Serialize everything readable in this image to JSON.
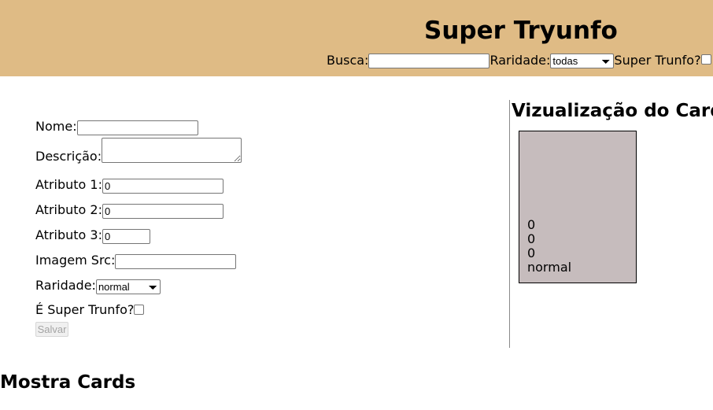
{
  "header": {
    "title": "Super Tryunfo",
    "filters": {
      "search_label": "Busca:",
      "search_value": "",
      "rarity_label": "Raridade:",
      "rarity_selected": "todas",
      "trunfo_label": "Super Trunfo?"
    }
  },
  "form": {
    "name_label": "Nome:",
    "name_value": "",
    "description_label": "Descrição:",
    "description_value": "",
    "attr1_label": "Atributo 1:",
    "attr1_value": "0",
    "attr2_label": "Atributo 2:",
    "attr2_value": "0",
    "attr3_label": "Atributo 3:",
    "attr3_value": "0",
    "image_label": "Imagem Src:",
    "image_value": "",
    "rarity_label": "Raridade:",
    "rarity_selected": "normal",
    "trunfo_label": "É Super Trunfo?",
    "save_label": "Salvar"
  },
  "preview": {
    "title": "Vizualização do Card",
    "card": {
      "attr1": "0",
      "attr2": "0",
      "attr3": "0",
      "rarity": "normal"
    }
  },
  "cards_section": {
    "title": "Mostra Cards"
  }
}
